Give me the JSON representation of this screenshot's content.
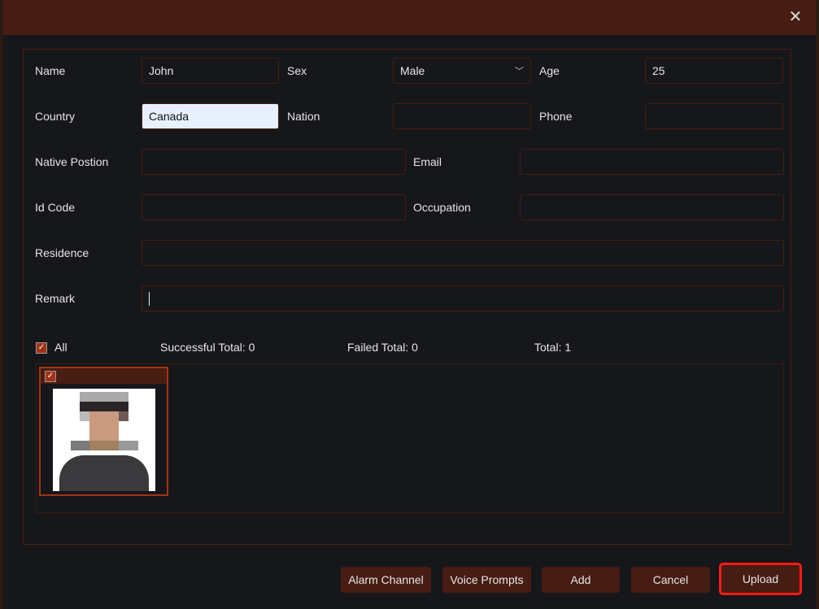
{
  "form": {
    "name_label": "Name",
    "name_value": "John",
    "sex_label": "Sex",
    "sex_value": "Male",
    "age_label": "Age",
    "age_value": "25",
    "country_label": "Country",
    "country_value": "Canada",
    "nation_label": "Nation",
    "nation_value": "",
    "phone_label": "Phone",
    "phone_value": "",
    "native_position_label": "Native Postion",
    "native_position_value": "",
    "email_label": "Email",
    "email_value": "",
    "id_code_label": "Id Code",
    "id_code_value": "",
    "occupation_label": "Occupation",
    "occupation_value": "",
    "residence_label": "Residence",
    "residence_value": "",
    "remark_label": "Remark",
    "remark_value": ""
  },
  "summary": {
    "all_label": "All",
    "all_checked": true,
    "successful": "Successful Total: 0",
    "failed": "Failed Total: 0",
    "total": "Total: 1"
  },
  "photos": [
    {
      "checked": true
    }
  ],
  "buttons": {
    "alarm_channel": "Alarm Channel",
    "voice_prompts": "Voice Prompts",
    "add": "Add",
    "cancel": "Cancel",
    "upload": "Upload"
  },
  "colors": {
    "header": "#471c12",
    "background": "#16171b",
    "accent": "#a33315",
    "highlight": "#ff1a1a"
  }
}
